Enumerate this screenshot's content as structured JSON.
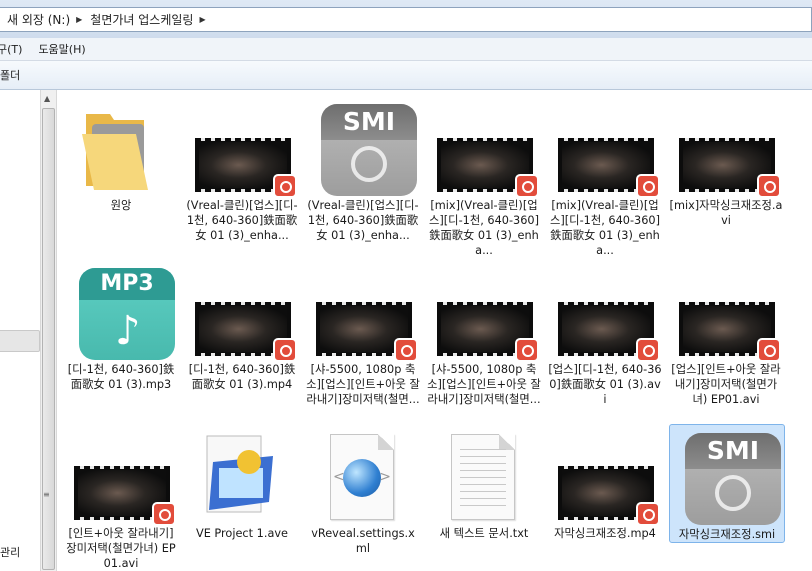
{
  "breadcrumb": {
    "items": [
      "새 외장 (N:)",
      "철면가녀 업스케일링"
    ]
  },
  "menu": {
    "items": [
      "구(T)",
      "도움말(H)"
    ]
  },
  "toolbar": {
    "items": [
      "폴더"
    ]
  },
  "nav": {
    "bottom_label": "관리"
  },
  "files": [
    {
      "name": "원앙",
      "type": "folder"
    },
    {
      "name": "(Vreal-클린)[업스][디-1천, 640-360]鉄面歌女 01 (3)_enha...",
      "type": "video"
    },
    {
      "name": "(Vreal-클린)[업스][디-1천, 640-360]鉄面歌女 01 (3)_enha...",
      "type": "smi"
    },
    {
      "name": "[mix](Vreal-클린)[업스][디-1천, 640-360]鉄面歌女 01 (3)_enha...",
      "type": "video"
    },
    {
      "name": "[mix](Vreal-클린)[업스][디-1천, 640-360]鉄面歌女 01 (3)_enha...",
      "type": "video"
    },
    {
      "name": "[mix]자막싱크재조정.avi",
      "type": "video"
    },
    {
      "name": "[디-1천, 640-360]鉄面歌女 01 (3).mp3",
      "type": "mp3"
    },
    {
      "name": "[디-1천, 640-360]鉄面歌女 01 (3).mp4",
      "type": "video"
    },
    {
      "name": "[샤-5500, 1080p 축소][업스][인트+아웃 잘라내기]장미저택(철면...",
      "type": "video"
    },
    {
      "name": "[샤-5500, 1080p 축소][업스][인트+아웃 잘라내기]장미저택(철면...",
      "type": "video"
    },
    {
      "name": "[업스][디-1천, 640-360]鉄面歌女 01 (3).avi",
      "type": "video"
    },
    {
      "name": "[업스][인트+아웃 잘라내기]장미저택(철면가녀) EP01.avi",
      "type": "video"
    },
    {
      "name": "[인트+아웃 잘라내기]장미저택(철면가녀) EP01.avi",
      "type": "video"
    },
    {
      "name": "VE Project 1.ave",
      "type": "project"
    },
    {
      "name": "vReveal.settings.xml",
      "type": "xml"
    },
    {
      "name": "새 텍스트 문서.txt",
      "type": "txt"
    },
    {
      "name": "자막싱크재조정.mp4",
      "type": "video"
    },
    {
      "name": "자막싱크재조정.smi",
      "type": "smi",
      "selected": true
    }
  ],
  "icon_text": {
    "smi": "SMI",
    "mp3": "MP3"
  },
  "colors": {
    "selection": "#cde4fb",
    "badge": "#e24c3b"
  }
}
